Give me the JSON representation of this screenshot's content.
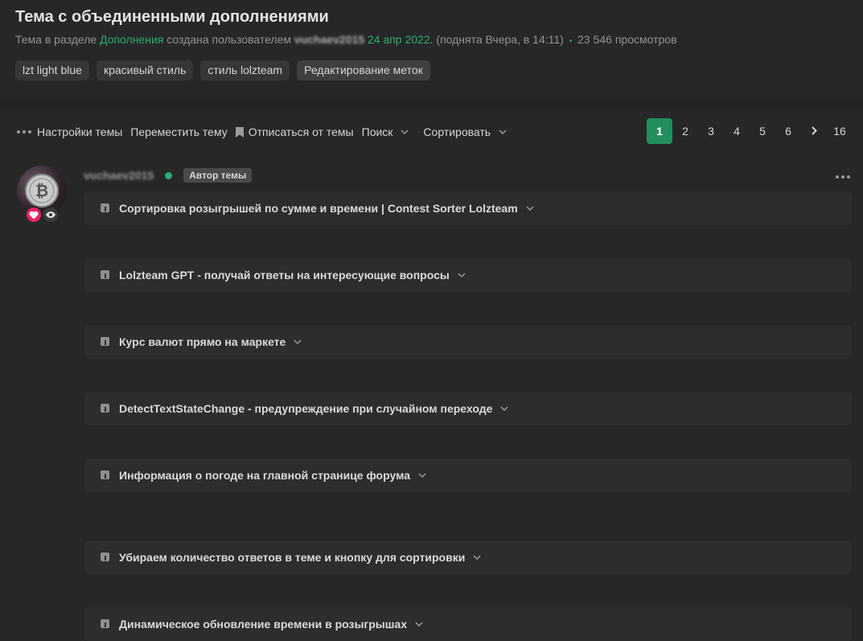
{
  "header": {
    "title": "Тема с объединенными дополнениями",
    "meta_prefix": "Тема в разделе",
    "section_link": "Дополнения",
    "created_by": "создана пользователем",
    "username": "vuchaev2015",
    "date": "24 апр 2022",
    "raised": ". (поднята Вчера, в 14:11)",
    "views": "23 546 просмотров",
    "tags": [
      "lzt light blue",
      "красивый стиль",
      "стиль lolzteam"
    ],
    "edit_tags": "Редактирование меток"
  },
  "toolbar": {
    "thread_settings": "Настройки темы",
    "move_thread": "Переместить тему",
    "unsubscribe": "Отписаться от темы",
    "search": "Поиск",
    "sort": "Сортировать"
  },
  "pagination": {
    "pages": [
      "1",
      "2",
      "3",
      "4",
      "5",
      "6"
    ],
    "current": "1",
    "last": "16"
  },
  "post": {
    "author": "vuchaev2015",
    "author_badge": "Автор темы",
    "spoilers": [
      "Сортировка розыгрышей по сумме и времени | Contest Sorter Lolzteam",
      "Lolzteam GPT - получай ответы на интересующие вопросы",
      "Курс валют прямо на маркете",
      "DetectTextStateChange - предупреждение при случайном переходе",
      "Информация о погоде на главной странице форума",
      "Убираем количество ответов в теме и кнопку для сортировки",
      "Динамическое обновление времени в розыгрышах"
    ]
  },
  "colors": {
    "accent": "#2bad72",
    "active_page": "#228e5d",
    "background": "#272727",
    "spoiler_bg": "#2d2d2d",
    "heart_badge": "#e72163"
  }
}
